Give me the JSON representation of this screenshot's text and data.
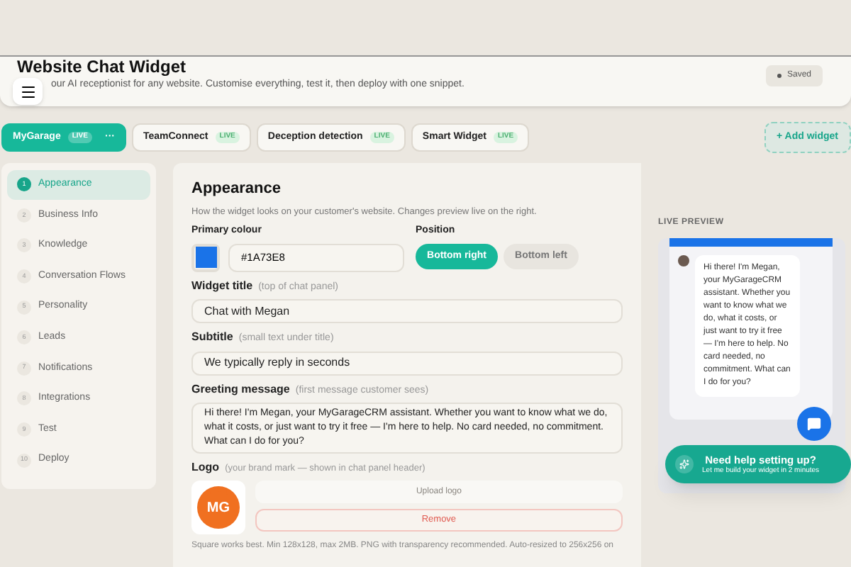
{
  "header": {
    "title": "Website Chat Widget",
    "subtitle": "our AI receptionist for any website. Customise everything, test it, then deploy with one snippet.",
    "status": "Saved"
  },
  "widget_tabs": [
    {
      "label": "MyGarage",
      "badge": "LIVE",
      "selected": true,
      "more": "···"
    },
    {
      "label": "TeamConnect",
      "badge": "LIVE",
      "selected": false
    },
    {
      "label": "Deception detection",
      "badge": "LIVE",
      "selected": false
    },
    {
      "label": "Smart Widget",
      "badge": "LIVE",
      "selected": false
    }
  ],
  "add_widget": "+ Add widget",
  "steps": [
    {
      "number": "1",
      "label": "Appearance",
      "selected": true
    },
    {
      "number": "2",
      "label": "Business Info",
      "selected": false
    },
    {
      "number": "3",
      "label": "Knowledge",
      "selected": false
    },
    {
      "number": "4",
      "label": "Conversation Flows",
      "selected": false
    },
    {
      "number": "5",
      "label": "Personality",
      "selected": false
    },
    {
      "number": "6",
      "label": "Leads",
      "selected": false
    },
    {
      "number": "7",
      "label": "Notifications",
      "selected": false
    },
    {
      "number": "8",
      "label": "Integrations",
      "selected": false
    },
    {
      "number": "9",
      "label": "Test",
      "selected": false
    },
    {
      "number": "10",
      "label": "Deploy",
      "selected": false
    }
  ],
  "form": {
    "title": "Appearance",
    "description": "How the widget looks on your customer's website. Changes preview live on the right.",
    "primary_colour": {
      "label": "Primary colour",
      "value": "#1A73E8",
      "color": "#1a73e8"
    },
    "position": {
      "label": "Position",
      "options": [
        {
          "label": "Bottom right",
          "selected": true
        },
        {
          "label": "Bottom left",
          "selected": false
        }
      ]
    },
    "widget_title": {
      "label": "Widget title",
      "hint": "(top of chat panel)",
      "value": "Chat with Megan"
    },
    "subtitle": {
      "label": "Subtitle",
      "hint": "(small text under title)",
      "value": "We typically reply in seconds"
    },
    "greeting": {
      "label": "Greeting message",
      "hint": "(first message customer sees)",
      "value": "Hi there! I'm Megan, your MyGarageCRM assistant. Whether you want to know what we do, what it costs, or just want to try it free — I'm here to help. No card needed, no commitment. What can I do for you?"
    },
    "logo": {
      "label": "Logo",
      "hint": "(your brand mark — shown in chat panel header)",
      "logo_text": "MG",
      "upload": "Upload logo",
      "remove": "Remove",
      "note": "Square works best. Min 128x128, max 2MB. PNG with transparency recommended. Auto-resized to 256x256 on"
    }
  },
  "preview": {
    "label": "LIVE PREVIEW",
    "message": "Hi there! I'm Megan, your MyGarageCRM assistant. Whether you want to know what we do, what it costs, or just want to try it free — I'm here to help. No card needed, no commitment. What can I do for you?"
  },
  "help": {
    "title": "Need help setting up?",
    "subtitle": "Let me build your widget in 2 minutes"
  }
}
